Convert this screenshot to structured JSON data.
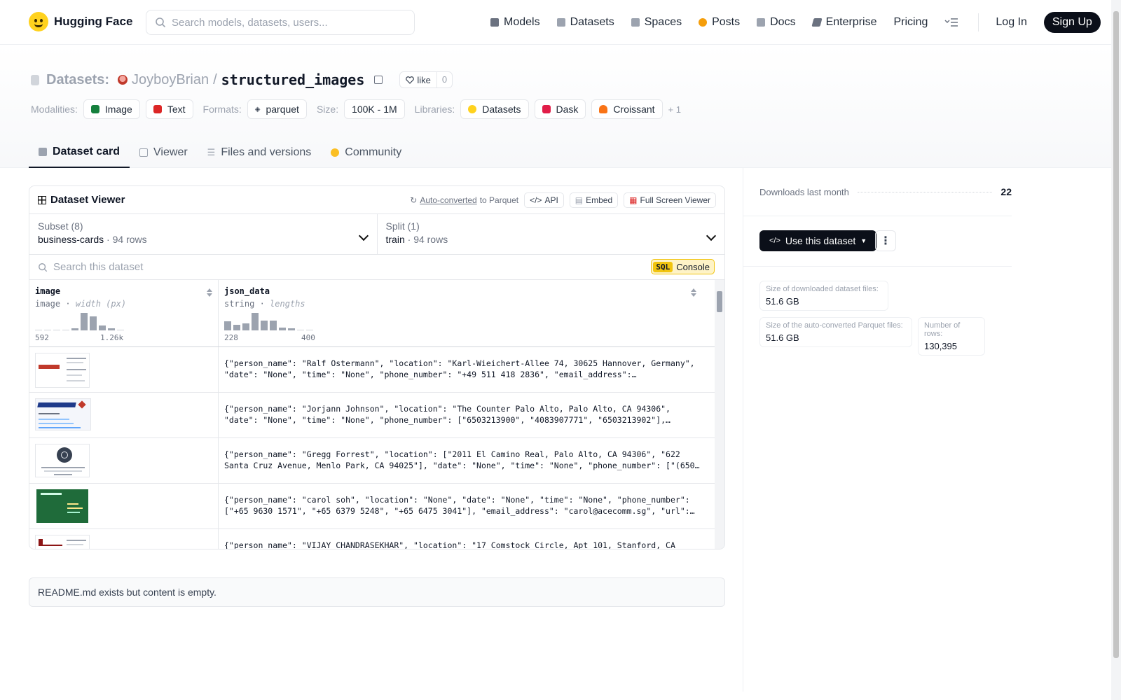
{
  "header": {
    "brand": "Hugging Face",
    "search_placeholder": "Search models, datasets, users...",
    "nav": [
      {
        "label": "Models",
        "icon": "model-icon",
        "color": "#6b7280"
      },
      {
        "label": "Datasets",
        "icon": "dataset-icon",
        "color": "#9ca3af"
      },
      {
        "label": "Spaces",
        "icon": "spaces-icon",
        "color": "#9ca3af"
      },
      {
        "label": "Posts",
        "icon": "posts-icon",
        "color": "#f59e0b"
      },
      {
        "label": "Docs",
        "icon": "docs-icon",
        "color": "#9ca3af"
      },
      {
        "label": "Enterprise",
        "icon": "enterprise-icon",
        "color": "#6b7280"
      },
      {
        "label": "Pricing",
        "icon": "",
        "color": ""
      }
    ],
    "login": "Log In",
    "signup": "Sign Up"
  },
  "repo": {
    "section": "Datasets:",
    "owner": "JoyboyBrian",
    "separator": "/",
    "name": "structured_images",
    "like_label": "like",
    "like_count": "0"
  },
  "meta": {
    "modalities_label": "Modalities:",
    "modalities": [
      {
        "label": "Image",
        "color": "#15803d"
      },
      {
        "label": "Text",
        "color": "#dc2626"
      }
    ],
    "formats_label": "Formats:",
    "format": "parquet",
    "size_label": "Size:",
    "size": "100K - 1M",
    "libraries_label": "Libraries:",
    "libraries": [
      {
        "label": "Datasets",
        "color": "#ffd21e"
      },
      {
        "label": "Dask",
        "color": "#e11d48"
      },
      {
        "label": "Croissant",
        "color": "#f97316"
      }
    ],
    "more": "+ 1"
  },
  "tabs": [
    {
      "label": "Dataset card",
      "active": true
    },
    {
      "label": "Viewer",
      "active": false
    },
    {
      "label": "Files and versions",
      "active": false
    },
    {
      "label": "Community",
      "active": false
    }
  ],
  "viewer": {
    "title": "Dataset Viewer",
    "auto_link": "Auto-converted",
    "auto_rest": "to Parquet",
    "api": "API",
    "embed": "Embed",
    "fullscreen": "Full Screen Viewer",
    "subset_label": "Subset (8)",
    "subset_value": "business-cards",
    "subset_rows": "94 rows",
    "split_label": "Split (1)",
    "split_value": "train",
    "split_rows": "94 rows",
    "search_placeholder": "Search this dataset",
    "sql_badge": "SQL",
    "sql_label": "Console",
    "columns": [
      {
        "name": "image",
        "type": "image",
        "stat": "width (px)",
        "min": "592",
        "max": "1.26k",
        "hist": [
          0.05,
          0.05,
          0.05,
          0,
          0.1,
          0.95,
          0.75,
          0.25,
          0.12,
          0.05
        ]
      },
      {
        "name": "json_data",
        "type": "string",
        "stat": "lengths",
        "min": "228",
        "max": "400",
        "hist": [
          0.5,
          0.3,
          0.4,
          0.95,
          0.55,
          0.55,
          0.15,
          0.12,
          0.05,
          0.05
        ]
      }
    ],
    "rows": [
      {
        "json": "{\"person_name\": \"Ralf Ostermann\", \"location\": \"Karl-Wieichert-Allee 74, 30625 Hannover, Germany\", \"date\": \"None\", \"time\": \"None\", \"phone_number\": \"+49 511 418 2836\", \"email_address\":…",
        "thumb": "thomson"
      },
      {
        "json": "{\"person_name\": \"Jorjann Johnson\", \"location\": \"The Counter Palo Alto, Palo Alto, CA 94306\", \"date\": \"None\", \"time\": \"None\", \"phone_number\": [\"6503213900\", \"4083907771\", \"6503213902\"],…",
        "thumb": "counter"
      },
      {
        "json": "{\"person_name\": \"Gregg Forrest\", \"location\": [\"2011 El Camino Real, Palo Alto, CA 94306\", \"622 Santa Cruz Avenue, Menlo Park, CA 94025\"], \"date\": \"None\", \"time\": \"None\", \"phone_number\": [\"(650…",
        "thumb": "seal"
      },
      {
        "json": "{\"person_name\": \"carol soh\", \"location\": \"None\", \"date\": \"None\", \"time\": \"None\", \"phone_number\": [\"+65 9630 1571\", \"+65 6379 5248\", \"+65 6475 3041\"], \"email_address\": \"carol@acecomm.sg\", \"url\":…",
        "thumb": "green"
      },
      {
        "json": "{\"person_name\": \"VIJAY CHANDRASEKHAR\", \"location\": \"17 Comstock Circle, Apt 101, Stanford, CA",
        "thumb": "stanford"
      }
    ]
  },
  "readme": "README.md exists but content is empty.",
  "side": {
    "downloads_label": "Downloads last month",
    "downloads_value": "22",
    "use_button": "Use this dataset",
    "stats": [
      {
        "label": "Size of downloaded dataset files:",
        "value": "51.6 GB"
      },
      {
        "label": "Size of the auto-converted Parquet files:",
        "value": "51.6 GB"
      },
      {
        "label": "Number of rows:",
        "value": "130,395"
      }
    ]
  }
}
